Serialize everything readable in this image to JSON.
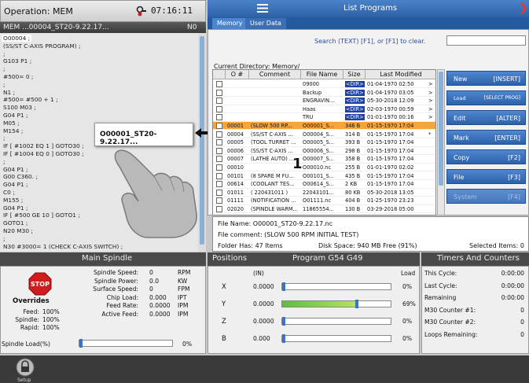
{
  "status": {
    "operation": "Operation: MEM",
    "time": "07:16:11"
  },
  "program": {
    "header_name": "MEM         ...00004_ST20-9.22.17...",
    "header_n": "N0",
    "lines": [
      "O00004 ;",
      "(SS/ST C-AXIS PROGRAM) ;",
      ";",
      "G103 P1 ;",
      ";",
      "#500= 0 ;",
      ";",
      "N1 ;",
      "#500= #500 + 1 ;",
      "S100 M03 ;",
      "G04 P1 ;",
      "M05 ;",
      "M154 ;",
      ";",
      "IF [ #1002 EQ 1 ] GOTO30 ;",
      "IF [ #1004 EQ 0 ] GOTO30 ;",
      ";",
      "G04 P1 ;",
      "G00 C360. ;",
      "G04 P1 ;",
      "C0 ;",
      "M155 ;",
      "G04 P1 ;",
      "IF [ #500 GE 10 ] GOTO1 ;",
      "GOTO1 ;",
      "N20 M30 ;",
      ";",
      "N30 #3000= 1 (CHECK C-AXIS SWITCH) ;"
    ]
  },
  "callout": {
    "text": "O00001_ST20-9.22.17...",
    "number": "1"
  },
  "list_programs": {
    "title": "List Programs",
    "tabs": [
      "Memory",
      "User Data"
    ],
    "search_hint": "Search (TEXT) [F1], or [F1] to clear.",
    "search_value": "",
    "current_dir": "Current Directory: Memory/",
    "columns": [
      "O #",
      "Comment",
      "File Name",
      "Size",
      "Last Modified"
    ],
    "rows": [
      {
        "o": "",
        "comment": "",
        "file": "09000",
        "size": "<DIR>",
        "mod": "01-04-1970 02:50",
        "flag": ">"
      },
      {
        "o": "",
        "comment": "",
        "file": "Backup",
        "size": "<DIR>",
        "mod": "01-04-1970 03:05",
        "flag": ">"
      },
      {
        "o": "",
        "comment": "",
        "file": "ENGRAVIN...",
        "size": "<DIR>",
        "mod": "05-30-2018 12:09",
        "flag": ">"
      },
      {
        "o": "",
        "comment": "",
        "file": "Haas",
        "size": "<DIR>",
        "mod": "02-03-1970 00:59",
        "flag": ">"
      },
      {
        "o": "",
        "comment": "",
        "file": "TRU",
        "size": "<DIR>",
        "mod": "01-01-1970 00:16",
        "flag": ">"
      },
      {
        "o": "00001",
        "comment": "(SLOW 500 RP...",
        "file": "O00001_S...",
        "size": "346 B",
        "mod": "01-15-1970 17:04",
        "flag": ""
      },
      {
        "o": "00004",
        "comment": "(SS/ST C-AXIS ...",
        "file": "O00004_S...",
        "size": "314 B",
        "mod": "01-15-1970 17:04",
        "flag": "*"
      },
      {
        "o": "00005",
        "comment": "(TOOL TURRET ...",
        "file": "O00005_S...",
        "size": "393 B",
        "mod": "01-15-1970 17:04",
        "flag": ""
      },
      {
        "o": "00006",
        "comment": "(SS/ST C-AXIS ...",
        "file": "O00006_S...",
        "size": "298 B",
        "mod": "01-15-1970 17:04",
        "flag": ""
      },
      {
        "o": "00007",
        "comment": "(LATHE AUTO) ...",
        "file": "O00007_S...",
        "size": "358 B",
        "mod": "01-15-1970 17:04",
        "flag": ""
      },
      {
        "o": "00010",
        "comment": "",
        "file": "O00010.nc",
        "size": "255 B",
        "mod": "01-01-1970 02:02",
        "flag": ""
      },
      {
        "o": "00101",
        "comment": "(8 SPARE M FU...",
        "file": "O00101_S...",
        "size": "435 B",
        "mod": "01-15-1970 17:04",
        "flag": ""
      },
      {
        "o": "00614",
        "comment": "(COOLANT TES...",
        "file": "O00614_S...",
        "size": "2 KB",
        "mod": "01-15-1970 17:04",
        "flag": ""
      },
      {
        "o": "01011",
        "comment": "( 220431011 )",
        "file": "22043101...",
        "size": "80 KB",
        "mod": "05-30-2018 13:05",
        "flag": ""
      },
      {
        "o": "01111",
        "comment": "(NOTIFICATION ...",
        "file": "O01111.nc",
        "size": "404 B",
        "mod": "01-25-1970 23:23",
        "flag": ""
      },
      {
        "o": "02020",
        "comment": "(SPINDLE WARM...",
        "file": "11865554...",
        "size": "130 B",
        "mod": "03-29-2018 05:00",
        "flag": ""
      }
    ],
    "buttons": [
      {
        "label": "New",
        "key": "[INSERT]"
      },
      {
        "label": "Load",
        "key": "[SELECT PROG]"
      },
      {
        "label": "Edit",
        "key": "[ALTER]"
      },
      {
        "label": "Mark",
        "key": "[ENTER]"
      },
      {
        "label": "Copy",
        "key": "[F2]"
      },
      {
        "label": "File",
        "key": "[F3]"
      },
      {
        "label": "System",
        "key": "[F4]"
      }
    ],
    "file_name": "File Name: O00001_ST20-9.22.17.nc",
    "file_comment": "File comment: (SLOW 500 RPM INITIAL TEST)",
    "folder_has": "Folder Has: 47 Items",
    "disk_space": "Disk Space: 940 MB Free (91%)",
    "selected": "Selected Items: 0"
  },
  "spindle": {
    "title": "Main Spindle",
    "stop": "STOP",
    "overrides": "Overrides",
    "stats": [
      {
        "k": "Spindle Speed:",
        "v": "0",
        "u": "RPM"
      },
      {
        "k": "Spindle Power:",
        "v": "0.0",
        "u": "KW"
      },
      {
        "k": "Surface Speed:",
        "v": "0",
        "u": "FPM"
      },
      {
        "k": "Chip Load:",
        "v": "0.000",
        "u": "IPT"
      },
      {
        "k": "Feed Rate:",
        "v": "0.0000",
        "u": "IPM"
      },
      {
        "k": "Active Feed:",
        "v": "0.0000",
        "u": "IPM"
      }
    ],
    "ovr": [
      {
        "k": "Feed:",
        "v": "100%"
      },
      {
        "k": "Spindle:",
        "v": "100%"
      },
      {
        "k": "Rapid:",
        "v": "100%"
      }
    ],
    "load_label": "Spindle Load(%)",
    "load_value": "0%",
    "load_fraction": 0.0
  },
  "positions": {
    "title": "Positions",
    "program": "Program G54 G49",
    "unit": "(IN)",
    "load_label": "Load",
    "axes": [
      {
        "axis": "X",
        "value": "0.0000",
        "load": "0%",
        "fill": 0.0
      },
      {
        "axis": "Y",
        "value": "0.0000",
        "load": "69%",
        "fill": 0.69
      },
      {
        "axis": "Z",
        "value": "0.0000",
        "load": "0%",
        "fill": 0.0
      },
      {
        "axis": "B",
        "value": "0.000",
        "load": "0%",
        "fill": 0.0
      }
    ]
  },
  "timers": {
    "title": "Timers And Counters",
    "rows": [
      {
        "k": "This Cycle:",
        "v": "0:00:00"
      },
      {
        "k": "Last Cycle:",
        "v": "0:00:00"
      },
      {
        "k": "Remaining",
        "v": "0:00:00"
      },
      {
        "k": "M30 Counter #1:",
        "v": "0"
      },
      {
        "k": "M30 Counter #2:",
        "v": "0"
      },
      {
        "k": "Loops Remaining:",
        "v": "0"
      }
    ]
  },
  "footer": {
    "setup": "Setup"
  },
  "colors": {
    "accent": "#2e62a6",
    "selected_row": "#f7a43a",
    "stop": "#d01c1c"
  }
}
